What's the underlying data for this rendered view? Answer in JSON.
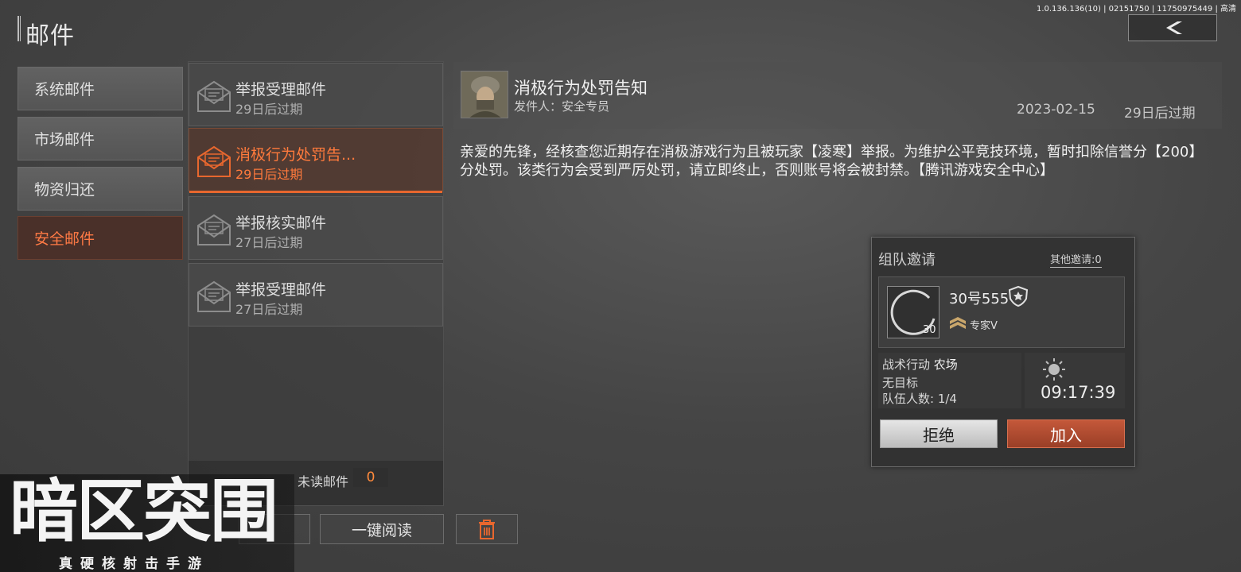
{
  "version": "1.0.136.136(10) | 02151750 | 11750975449 | 高清",
  "page_title": "邮件",
  "categories": [
    {
      "label": "系统邮件",
      "active": false
    },
    {
      "label": "市场邮件",
      "active": false
    },
    {
      "label": "物资归还",
      "active": false
    },
    {
      "label": "安全邮件",
      "active": true
    }
  ],
  "mails": [
    {
      "subject": "举报受理邮件",
      "expire": "29日后过期",
      "active": false
    },
    {
      "subject": "消极行为处罚告...",
      "expire": "29日后过期",
      "active": true
    },
    {
      "subject": "举报核实邮件",
      "expire": "27日后过期",
      "active": false
    },
    {
      "subject": "举报受理邮件",
      "expire": "27日后过期",
      "active": false
    }
  ],
  "unread": {
    "label": "未读邮件",
    "count": "0"
  },
  "actions": {
    "read_all": "一键阅读"
  },
  "detail": {
    "title": "消极行为处罚告知",
    "sender": "发件人：安全专员",
    "date": "2023-02-15",
    "expire": "29日后过期",
    "body": "亲爱的先锋，经核查您近期存在消极游戏行为且被玩家【凌寒】举报。为维护公平竞技环境，暂时扣除信誉分【200】分处罚。该类行为会受到严厉处罚，请立即终止，否则账号将会被封禁。【腾讯游戏安全中心】"
  },
  "invite": {
    "title": "组队邀请",
    "other": "其他邀请:0",
    "player_level": "30",
    "player_name": "30号555",
    "rank": "专家V",
    "mode_label": "战术行动",
    "mode_map": "农场",
    "target": "无目标",
    "team": "队伍人数: 1/4",
    "time": "09:17:39",
    "reject": "拒绝",
    "join": "加入"
  },
  "logo": {
    "main": "暗区突围",
    "sub": "真硬核射击手游"
  },
  "colors": {
    "accent": "#ff7a3c",
    "join": "#b04a30"
  }
}
